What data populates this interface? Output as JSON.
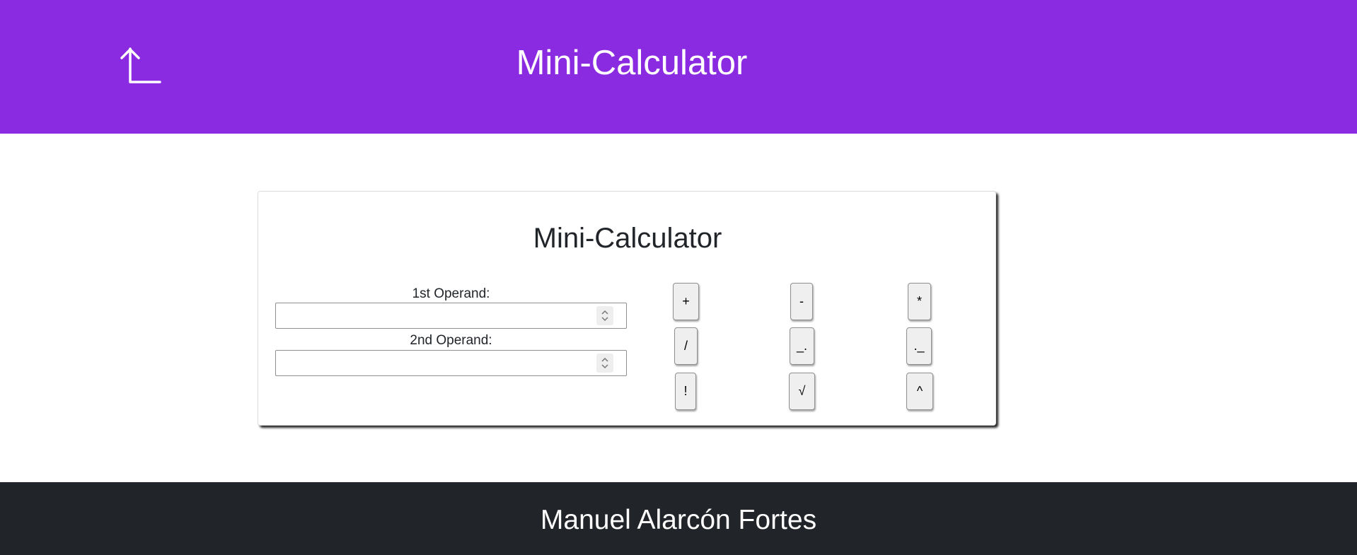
{
  "header": {
    "title": "Mini-Calculator",
    "back_icon": "arrow-up-left-corner-icon",
    "background_color": "#8a2be2"
  },
  "calculator": {
    "title": "Mini-Calculator",
    "first_operand": {
      "label": "1st Operand:",
      "value": "",
      "spinner_icon": "number-spinner-icon"
    },
    "second_operand": {
      "label": "2nd Operand:",
      "value": "",
      "spinner_icon": "number-spinner-icon"
    },
    "operations": [
      {
        "label": "+"
      },
      {
        "label": "-"
      },
      {
        "label": "*"
      },
      {
        "label": "/"
      },
      {
        "label": "_."
      },
      {
        "label": "._"
      },
      {
        "label": "!"
      },
      {
        "label": "√"
      },
      {
        "label": "^"
      }
    ]
  },
  "footer": {
    "author": "Manuel Alarcón Fortes",
    "background_color": "#212428"
  }
}
